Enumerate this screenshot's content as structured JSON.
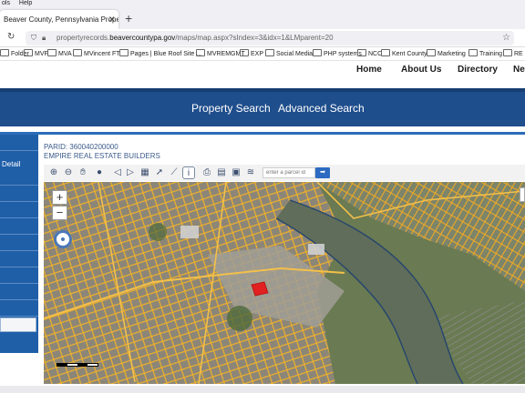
{
  "browser": {
    "menu_items": [
      "ols",
      "Help"
    ],
    "tab_title": "Beaver County, Pennsylvania Prope",
    "tab_close": "✕",
    "new_tab": "+",
    "url_prefix": "propertyrecords.",
    "url_domain": "beavercountypa.gov",
    "url_path": "/maps/map.aspx?sIndex=3&idx=1&LMparent=20",
    "bookmarks": [
      "Folder",
      "MVF",
      "MVA",
      "MVincent FT",
      "Pages | Blue Roof Site ...",
      "MVREMGMT",
      "EXP",
      "Social Media",
      "PHP systems",
      "NCC",
      "Kent County",
      "Marketing",
      "Training",
      "RE sc"
    ]
  },
  "site": {
    "top_nav": [
      "Home",
      "About Us",
      "Directory",
      "New"
    ],
    "search_links": [
      "Property Search",
      "Advanced Search"
    ],
    "left_panel_label": "Detail"
  },
  "record": {
    "parid": "PARID: 360040200000",
    "owner": "EMPIRE REAL ESTATE BUILDERS"
  },
  "map": {
    "parcel_placeholder": "enter a parcel id",
    "zoom_in": "+",
    "zoom_out": "−",
    "tools": [
      "zoom-in-icon",
      "zoom-out-icon",
      "pan-hand-icon",
      "globe-icon",
      "back-arrow-icon",
      "forward-arrow-icon",
      "full-extent-icon",
      "select-arrow-icon",
      "measure-icon",
      "identify-info-icon",
      "print-icon",
      "overlay-icon",
      "photo-icon",
      "layers-icon"
    ]
  }
}
